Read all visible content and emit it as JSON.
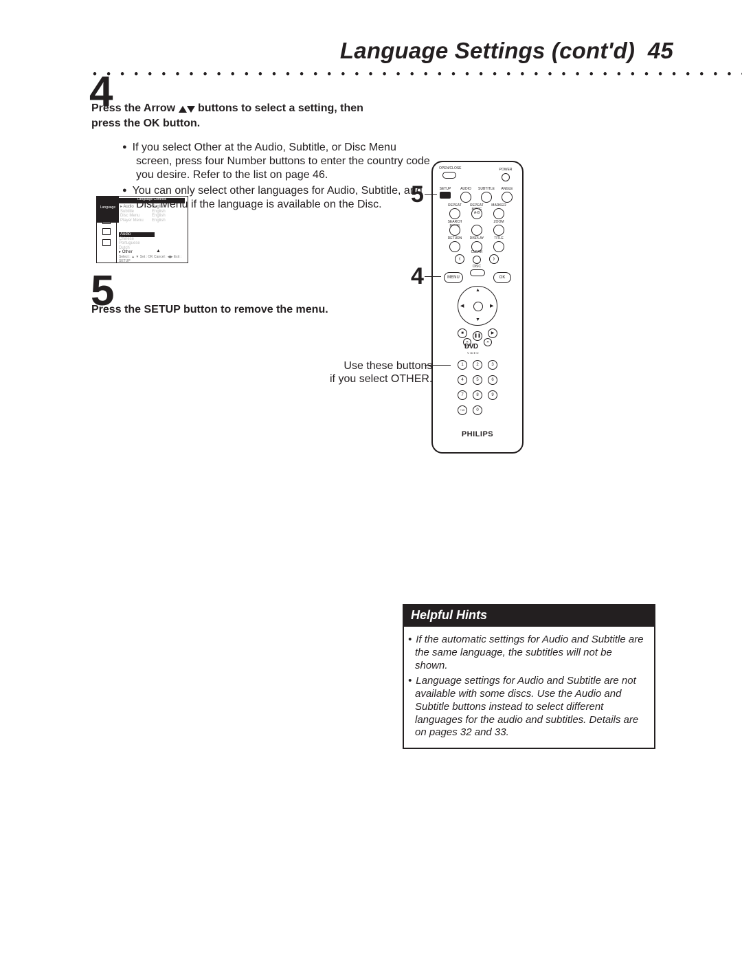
{
  "header": {
    "title": "Language Settings (cont'd)",
    "page": "45"
  },
  "step4": {
    "num": "4",
    "heading_pre": "Press the Arrow",
    "heading_post": "buttons to select a setting, then press the OK button.",
    "bullets": [
      "If you select Other at the Audio, Subtitle, or Disc Menu screen, press four Number buttons to enter the country code you desire. Refer to the list on page 46.",
      "You can only select other languages for Audio, Subtitle, and Disc Menu if the language is available on the Disc."
    ]
  },
  "step5": {
    "num": "5",
    "heading": "Press the SETUP button to remove the menu."
  },
  "callout": {
    "label_5": "5",
    "label_4": "4",
    "number_hint_line1": "Use these buttons",
    "number_hint_line2": "if you select OTHER."
  },
  "osd": {
    "title": "Language Controls",
    "left_tab": "Language",
    "col_values": [
      "English",
      "English",
      "English",
      "English"
    ],
    "rowsA": [
      "Audio",
      "Subtitle",
      "Disc Menu",
      "Player Menu"
    ],
    "panelB_title": "Audio",
    "rowsB": [
      "Chinese",
      "Portuguese",
      "Dutch",
      "Other"
    ],
    "footer": "Select :  ▲ ▼   Set : OK    Cancel : ◀▶   Exit : SETUP"
  },
  "remote": {
    "top_labels": [
      "OPEN/CLOSE",
      "POWER"
    ],
    "row2_labels": [
      "SETUP",
      "AUDIO",
      "SUBTITLE",
      "ANGLE"
    ],
    "row3_labels": [
      "REPEAT",
      "REPEAT MODE",
      "MARKER"
    ],
    "row4_labels": [
      "SEARCH MODE",
      "A-B",
      "ZOOM"
    ],
    "row5_labels": [
      "RETURN",
      "DISPLAY",
      "TITLE"
    ],
    "clear": "CLEAR",
    "disc": "DISC",
    "menu": "MENU",
    "ok": "OK",
    "dvd": "DVD",
    "dvd_sub": "VIDEO",
    "numbers": [
      "1",
      "2",
      "3",
      "4",
      "5",
      "6",
      "7",
      "8",
      "9",
      "+10",
      "0"
    ],
    "brand": "PHILIPS"
  },
  "hints": {
    "title": "Helpful Hints",
    "items": [
      "If the automatic settings for Audio and Subtitle are the same language, the subtitles will not be shown.",
      "Language settings for Audio and Subtitle are not available with some discs. Use the Audio and Subtitle buttons instead to select different languages for the audio and subtitles. Details are on pages 32 and 33."
    ]
  }
}
